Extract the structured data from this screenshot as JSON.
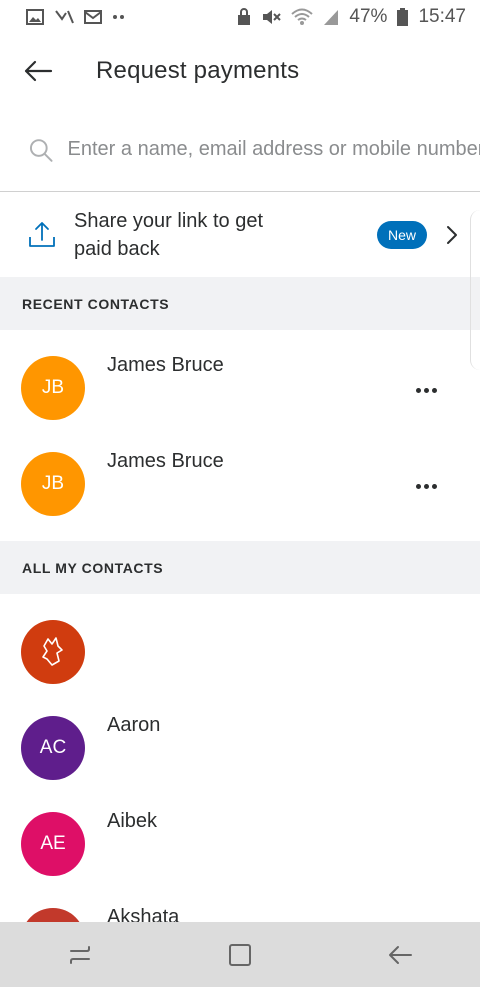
{
  "status_bar": {
    "battery": "47%",
    "time": "15:47",
    "left_icons": [
      "image-icon",
      "missed-call-icon",
      "mail-icon",
      "more-dots-icon"
    ],
    "right_icons": [
      "lock-icon",
      "mute-icon",
      "wifi-icon",
      "signal-icon",
      "battery-icon"
    ]
  },
  "header": {
    "title": "Request payments",
    "back_icon": "arrow-left-icon"
  },
  "search": {
    "placeholder": "Enter a name, email address or mobile number",
    "icon": "search-icon"
  },
  "share": {
    "label": "Share your link to get paid back",
    "badge": "New",
    "icon": "upload-icon"
  },
  "recent_contacts": {
    "header": "RECENT CONTACTS",
    "items": [
      {
        "initials": "JB",
        "name": "James Bruce",
        "color": "#ff9600"
      },
      {
        "initials": "JB",
        "name": "James Bruce",
        "color": "#ff9600"
      }
    ]
  },
  "all_contacts": {
    "header": "ALL MY CONTACTS",
    "items": [
      {
        "initials": "",
        "name": "",
        "color": "#d03c0f"
      },
      {
        "initials": "AC",
        "name": "Aaron",
        "color": "#5f1e8c"
      },
      {
        "initials": "AE",
        "name": "Aibek",
        "color": "#de0f67"
      },
      {
        "initials": "",
        "name": "Akshata",
        "color": "#c2392b"
      }
    ]
  },
  "colors": {
    "accent": "#0070ba",
    "section_bg": "#f1f2f4",
    "nav_bg": "#dcdcdc"
  },
  "nav_bar": {
    "icons": [
      "recent-apps-icon",
      "home-icon",
      "back-icon"
    ]
  }
}
